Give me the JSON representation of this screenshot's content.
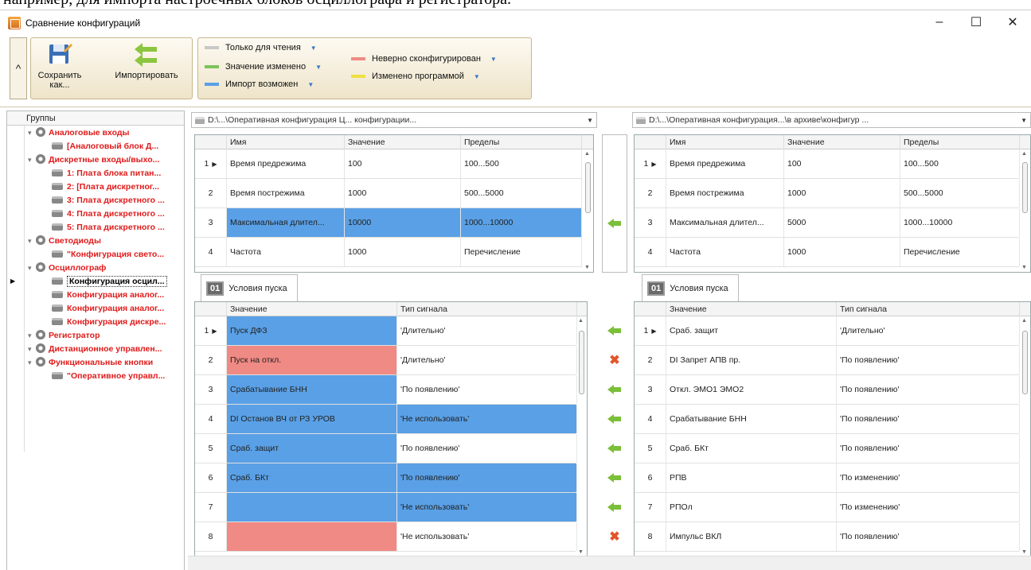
{
  "doc_line": "например, для импорта настроечных блоков осциллографа и регистратора.",
  "window": {
    "title": "Сравнение конфигураций",
    "minimize": "–",
    "maximize": "☐",
    "close": "✕"
  },
  "ribbon": {
    "collapse": "^",
    "save_label": "Сохранить как...",
    "import_label": "Импортировать",
    "legend": {
      "readonly": "Только для чтения",
      "changed": "Значение изменено",
      "import_possible": "Импорт возможен",
      "misconfigured": "Неверно сконфигурирован",
      "changed_by_program": "Изменено программой"
    },
    "colors": {
      "readonly": "#c8c8c8",
      "changed": "#7cc35a",
      "import_possible": "#5aa0e6",
      "misconfigured": "#f08a84",
      "changed_by_program": "#f0e040"
    }
  },
  "groups": {
    "header": "Группы",
    "items": [
      {
        "label": "Аналоговые входы",
        "level": 1
      },
      {
        "label": "[Аналоговый блок Д...",
        "level": 2
      },
      {
        "label": "Дискретные входы/выхо...",
        "level": 1
      },
      {
        "label": "1: Плата блока питан...",
        "level": 2
      },
      {
        "label": "2: [Плата дискретног...",
        "level": 2
      },
      {
        "label": "3: Плата дискретного ...",
        "level": 2
      },
      {
        "label": "4: Плата дискретного ...",
        "level": 2
      },
      {
        "label": "5: Плата дискретного ...",
        "level": 2
      },
      {
        "label": "Светодиоды",
        "level": 1
      },
      {
        "label": "\"Конфигурация свето...",
        "level": 2
      },
      {
        "label": "Осциллограф",
        "level": 1
      },
      {
        "label": "Конфигурация осцил...",
        "level": 2,
        "selected": true
      },
      {
        "label": "Конфигурация аналог...",
        "level": 2
      },
      {
        "label": "Конфигурация аналог...",
        "level": 2
      },
      {
        "label": "Конфигурация дискре...",
        "level": 2
      },
      {
        "label": "Регистратор",
        "level": 1
      },
      {
        "label": "Дистанционное управлен...",
        "level": 1
      },
      {
        "label": "Функциональные кнопки",
        "level": 1
      },
      {
        "label": "\"Оперативное управл...",
        "level": 2
      }
    ]
  },
  "left": {
    "path": "D:\\...\\Оперативная конфигурация Ц... конфигурации...",
    "params_headers": [
      "Имя",
      "Значение",
      "Пределы"
    ],
    "params": [
      {
        "n": "1",
        "name": "Время предрежима",
        "value": "100",
        "limits": "100...500",
        "hl": ""
      },
      {
        "n": "2",
        "name": "Время пострежима",
        "value": "1000",
        "limits": "500...5000",
        "hl": ""
      },
      {
        "n": "3",
        "name": "Максимальная длител...",
        "value": "10000",
        "limits": "1000...10000",
        "hl": "blue"
      },
      {
        "n": "4",
        "name": "Частота",
        "value": "1000",
        "limits": "Перечисление",
        "hl": ""
      }
    ],
    "tab": {
      "icon": "01",
      "label": "Условия пуска"
    },
    "cond_headers": [
      "Значение",
      "Тип сигнала"
    ],
    "conds": [
      {
        "n": "1",
        "value": "Пуск ДФЗ",
        "type": "'Длительно'",
        "v_hl": "blue",
        "t_hl": ""
      },
      {
        "n": "2",
        "value": "Пуск на откл.",
        "type": "'Длительно'",
        "v_hl": "red",
        "t_hl": ""
      },
      {
        "n": "3",
        "value": "Срабатывание БНН",
        "type": "'По появлению'",
        "v_hl": "blue",
        "t_hl": ""
      },
      {
        "n": "4",
        "value": "DI Останов ВЧ от РЗ УРОВ",
        "type": "'Не использовать'",
        "v_hl": "blue",
        "t_hl": "blue"
      },
      {
        "n": "5",
        "value": "Сраб. защит",
        "type": "'По появлению'",
        "v_hl": "blue",
        "t_hl": ""
      },
      {
        "n": "6",
        "value": "Сраб. БКт",
        "type": "'По появлению'",
        "v_hl": "blue",
        "t_hl": "blue"
      },
      {
        "n": "7",
        "value": "",
        "type": "'Не использовать'",
        "v_hl": "blue",
        "t_hl": "blue"
      },
      {
        "n": "8",
        "value": "",
        "type": "'Не использовать'",
        "v_hl": "red",
        "t_hl": ""
      }
    ]
  },
  "right": {
    "path": "D:\\...\\Оперативная конфигурация...\\в архиве\\конфигур ...",
    "params_headers": [
      "Имя",
      "Значение",
      "Пределы"
    ],
    "params": [
      {
        "n": "1",
        "name": "Время предрежима",
        "value": "100",
        "limits": "100...500"
      },
      {
        "n": "2",
        "name": "Время пострежима",
        "value": "1000",
        "limits": "500...5000"
      },
      {
        "n": "3",
        "name": "Максимальная длител...",
        "value": "5000",
        "limits": "1000...10000"
      },
      {
        "n": "4",
        "name": "Частота",
        "value": "1000",
        "limits": "Перечисление"
      }
    ],
    "tab": {
      "icon": "01",
      "label": "Условия пуска"
    },
    "cond_headers": [
      "Значение",
      "Тип сигнала"
    ],
    "conds": [
      {
        "n": "1",
        "value": "Сраб. защит",
        "type": "'Длительно'"
      },
      {
        "n": "2",
        "value": "DI Запрет АПВ пр.",
        "type": "'По появлению'"
      },
      {
        "n": "3",
        "value": "Откл. ЭМО1 ЭМО2",
        "type": "'По появлению'"
      },
      {
        "n": "4",
        "value": "Срабатывание БНН",
        "type": "'По появлению'"
      },
      {
        "n": "5",
        "value": "Сраб. БКт",
        "type": "'По появлению'"
      },
      {
        "n": "6",
        "value": "РПВ",
        "type": "'По изменению'"
      },
      {
        "n": "7",
        "value": "РПОл",
        "type": "'По изменению'"
      },
      {
        "n": "8",
        "value": "Импульс ВКЛ",
        "type": "'По появлению'"
      }
    ]
  },
  "mid_actions": {
    "params": [
      "",
      "",
      "arrow",
      ""
    ],
    "conds": [
      "arrow",
      "x",
      "arrow",
      "arrow",
      "arrow",
      "arrow",
      "arrow",
      "x"
    ]
  }
}
